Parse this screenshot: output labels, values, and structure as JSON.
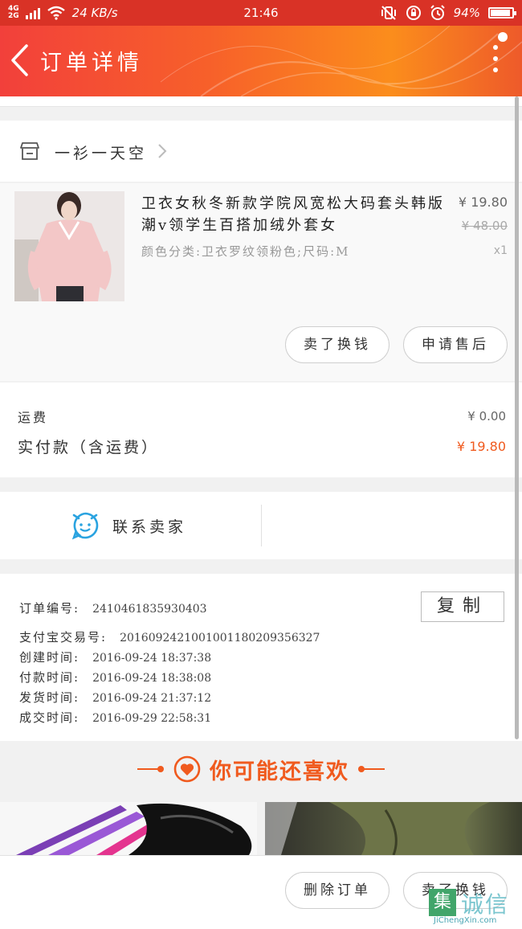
{
  "status_bar": {
    "network": "4G",
    "network2": "2G",
    "speed": "24 KB/s",
    "time": "21:46",
    "battery": "94%",
    "battery_level": 0.94
  },
  "header": {
    "title": "订单详情"
  },
  "shop": {
    "name": "一衫一天空"
  },
  "product": {
    "title": "卫衣女秋冬新款学院风宽松大码套头韩版潮v领学生百搭加绒外套女",
    "sku": "颜色分类:卫衣罗纹领粉色;尺码:M",
    "price": "¥ 19.80",
    "original_price": "¥ 48.00",
    "quantity": "x1",
    "buttons": {
      "resell": "卖了换钱",
      "after_sale": "申请售后"
    }
  },
  "costs": {
    "shipping_label": "运费",
    "shipping_value": "¥ 0.00",
    "paid_label": "实付款（含运费）",
    "paid_value": "¥ 19.80"
  },
  "contact": {
    "label": "联系卖家"
  },
  "order_info": {
    "copy_label": "复制",
    "rows": [
      {
        "label": "订单编号:",
        "value": "2410461835930403"
      },
      {
        "label": "支付宝交易号:",
        "value": "2016092421001001180209356327"
      },
      {
        "label": "创建时间:",
        "value": "2016-09-24 18:37:38"
      },
      {
        "label": "付款时间:",
        "value": "2016-09-24 18:38:08"
      },
      {
        "label": "发货时间:",
        "value": "2016-09-24 21:37:12"
      },
      {
        "label": "成交时间:",
        "value": "2016-09-29 22:58:31"
      }
    ]
  },
  "recommend": {
    "title": "你可能还喜欢"
  },
  "bottom_bar": {
    "delete_label": "删除订单",
    "resell_label": "卖了换钱"
  },
  "watermark": {
    "box_char": "集",
    "chinese": "诚信",
    "english": "JiChengXin.com"
  },
  "colors": {
    "accent": "#f05a1e",
    "header_start": "#f2403b",
    "header_end": "#fb8d1c",
    "status_bar": "#d93226"
  }
}
